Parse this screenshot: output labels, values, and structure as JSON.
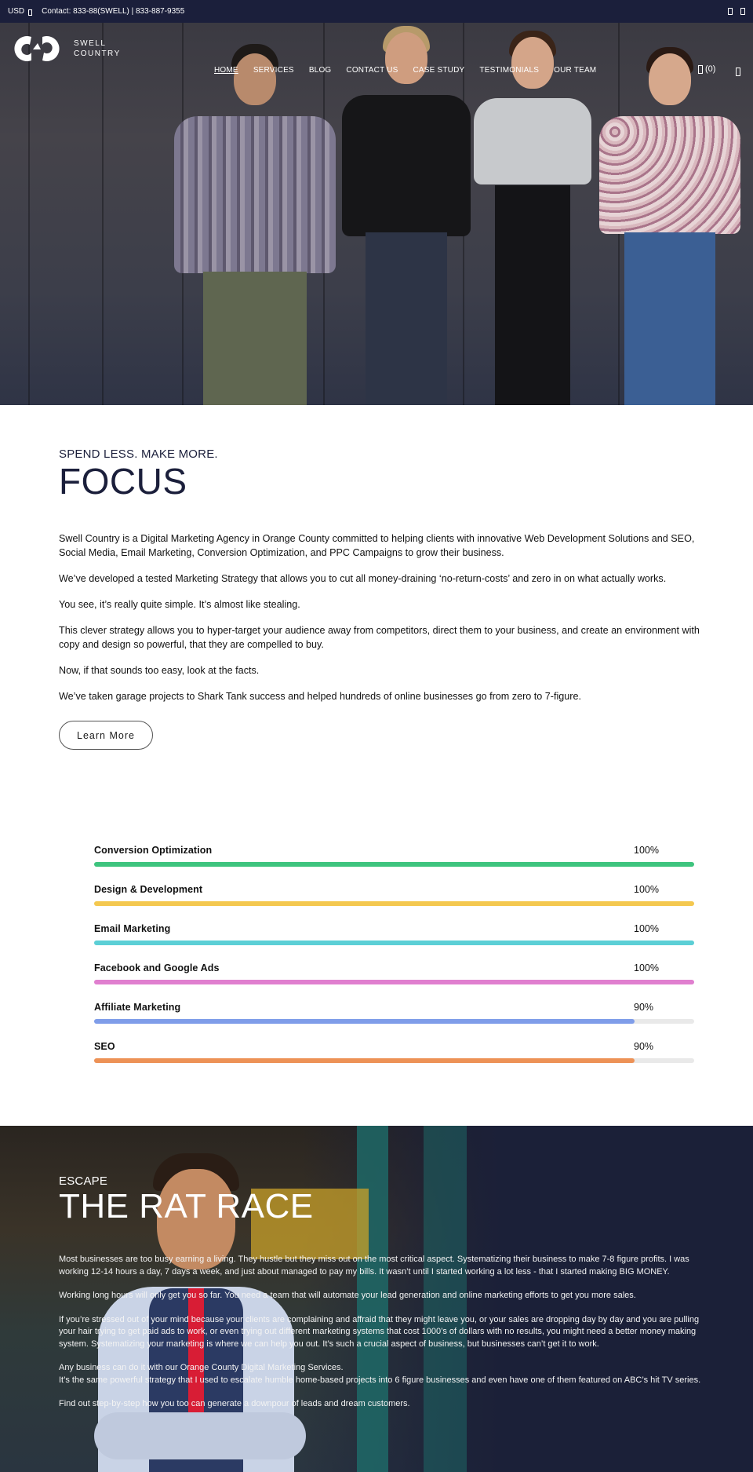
{
  "topbar": {
    "currency": "USD",
    "currency_icon": "chevron-down-icon",
    "contact": "Contact: 833-88(SWELL) | 833-887-9355",
    "right_icons": [
      "social-icon",
      "social-icon"
    ]
  },
  "header": {
    "logo_line1": "SWELL",
    "logo_line2": "COUNTRY",
    "nav": [
      {
        "label": "HOME",
        "active": true
      },
      {
        "label": "SERVICES",
        "active": false
      },
      {
        "label": "BLOG",
        "active": false
      },
      {
        "label": "CONTACT US",
        "active": false
      },
      {
        "label": "CASE STUDY",
        "active": false
      },
      {
        "label": "TESTIMONIALS",
        "active": false
      },
      {
        "label": "OUR TEAM",
        "active": false
      }
    ],
    "cart_count": "(0)",
    "cart_icon": "cart-icon",
    "menu_icon": "menu-icon"
  },
  "focus": {
    "eyebrow": "SPEND LESS. MAKE MORE.",
    "title": "FOCUS",
    "paragraphs": [
      "Swell Country is a Digital Marketing Agency in Orange County committed to helping clients with innovative Web Development Solutions and SEO, Social Media, Email Marketing, Conversion Optimization, and PPC Campaigns to grow their business.",
      "We’ve developed a tested Marketing Strategy that allows you to cut all money-draining ‘no-return-costs’ and zero in on what actually works.",
      "You see, it’s really quite simple. It’s almost like stealing.",
      "This clever strategy allows you to hyper-target your audience away from competitors, direct them to your business, and create an environment with copy and design so powerful, that they are compelled to buy.",
      "Now, if that sounds too easy, look at the facts.",
      "We’ve taken garage projects to Shark Tank success and helped hundreds of online businesses go from zero to 7-figure."
    ],
    "button_label": "Learn More"
  },
  "skills": [
    {
      "name": "Conversion Optimization",
      "percent_label": "100%",
      "value": 100,
      "color": "#3ec47e"
    },
    {
      "name": "Design & Development",
      "percent_label": "100%",
      "value": 100,
      "color": "#f4c84f"
    },
    {
      "name": "Email Marketing",
      "percent_label": "100%",
      "value": 100,
      "color": "#5ccfd6"
    },
    {
      "name": "Facebook and Google Ads",
      "percent_label": "100%",
      "value": 100,
      "color": "#e07fcf"
    },
    {
      "name": "Affiliate Marketing",
      "percent_label": "90%",
      "value": 90,
      "color": "#7f9de9"
    },
    {
      "name": "SEO",
      "percent_label": "90%",
      "value": 90,
      "color": "#ed9256"
    }
  ],
  "ratrace": {
    "eyebrow": "ESCAPE",
    "title": "THE RAT RACE",
    "paragraphs": [
      "Most businesses are too busy earning a living. They hustle but they miss out on the most critical aspect. Systematizing their business to make 7-8 figure profits. I was working 12-14 hours a day, 7 days a week, and just about managed to pay my bills. It wasn’t until I started working a lot less - that I started making BIG MONEY.",
      "Working long hours will only get you so far. You need a team that will automate your lead generation and online marketing efforts to get you more sales.",
      "If you’re stressed out of your mind because your clients are complaining and affraid that they might leave you, or your sales are dropping day by day and you are pulling your hair trying to get paid ads to work, or even trying out different marketing systems that cost 1000’s of dollars with no results, you might need a better money making system. Systematizing your marketing is where we can help you out. It’s such a crucial aspect of business, but businesses can’t get it to work.",
      "Any business can do it with our Orange County Digital Marketing Services.",
      "It’s the same powerful strategy that I used to escalate humble home-based projects into 6 figure businesses and even have one of them featured on ABC’s hit TV series.",
      "Find out step-by-step how you too can generate a downpour of leads and dream customers."
    ]
  },
  "colors": {
    "navy": "#1b1f3b",
    "ratrace_bg": "#1b2038"
  }
}
